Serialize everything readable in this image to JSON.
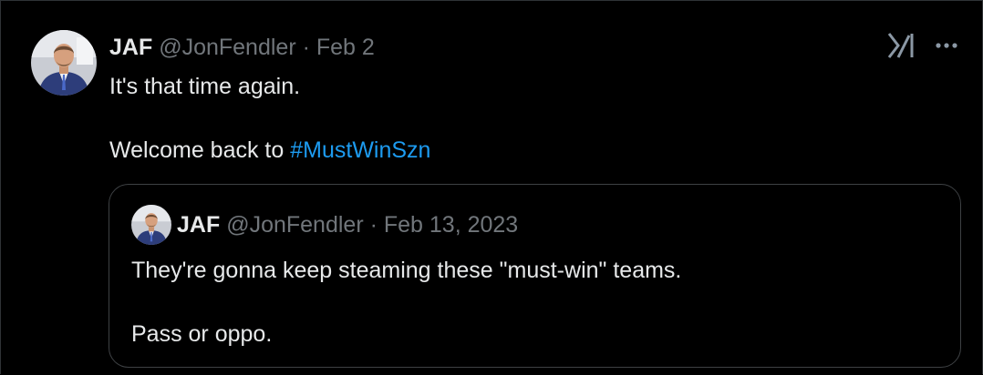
{
  "tweet": {
    "author_name": "JAF",
    "author_handle": "@JonFendler",
    "separator": "·",
    "date": "Feb 2",
    "text_line1": "It's that time again.",
    "text_line2_prefix": "Welcome back to ",
    "hashtag": "#MustWinSzn",
    "hashtag_color": "#1d9bf0",
    "icons": [
      "grok-icon",
      "more-icon"
    ]
  },
  "quoted_tweet": {
    "author_name": "JAF",
    "author_handle": "@JonFendler",
    "separator": "·",
    "date": "Feb 13, 2023",
    "text_line1": "They're gonna keep steaming these \"must-win\" teams.",
    "text_line2": "Pass or oppo."
  },
  "colors": {
    "background": "#000000",
    "text": "#e7e9ea",
    "muted": "#71767b",
    "border": "#3e4144"
  }
}
